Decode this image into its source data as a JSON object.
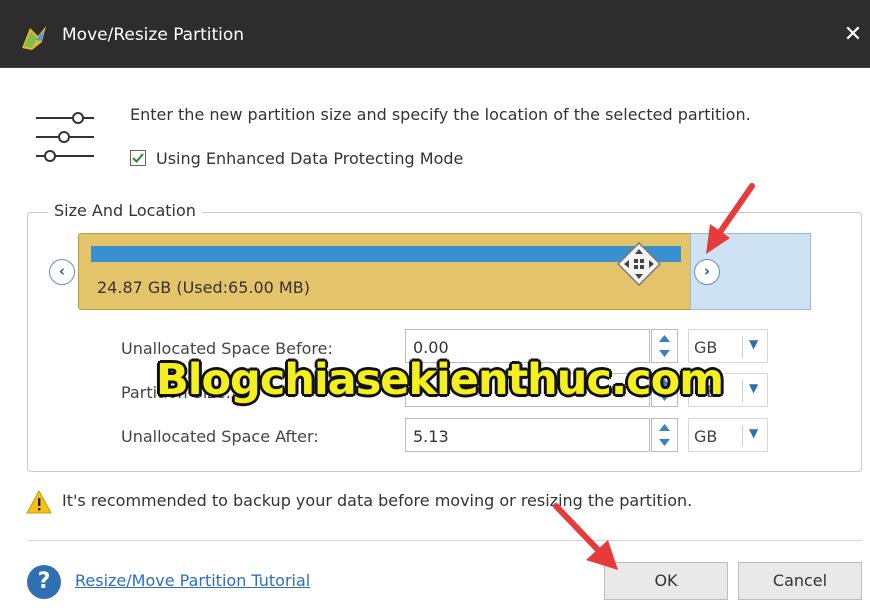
{
  "window": {
    "title": "Move/Resize Partition",
    "close_glyph": "✕"
  },
  "header": {
    "description": "Enter the new partition size and specify the location of the selected partition.",
    "enhanced_mode_label": "Using Enhanced Data Protecting Mode",
    "enhanced_mode_checked": true
  },
  "size_location": {
    "title": "Size And Location",
    "partition_label": "24.87 GB (Used:65.00 MB)",
    "left_nav": "‹",
    "right_nav": "›"
  },
  "fields": [
    {
      "label": "Unallocated Space Before:",
      "value": "0.00",
      "unit": "GB"
    },
    {
      "label": "Partition Size:",
      "value": "",
      "unit": "GB"
    },
    {
      "label": "Unallocated Space After:",
      "value": "5.13",
      "unit": "GB"
    }
  ],
  "watermark": "Blogchiasekienthuc.com",
  "warning": "It's recommended to backup your data before moving or resizing the partition.",
  "footer": {
    "help_glyph": "?",
    "tutorial_link": "Resize/Move Partition Tutorial",
    "ok_label": "OK",
    "cancel_label": "Cancel"
  },
  "colors": {
    "titlebar": "#2d2d2d",
    "partition": "#e4c46a",
    "used_strip": "#3a8fcf",
    "unallocated": "#cfe2f4",
    "arrow": "#e63b3b",
    "watermark": "#f4ef1f"
  }
}
